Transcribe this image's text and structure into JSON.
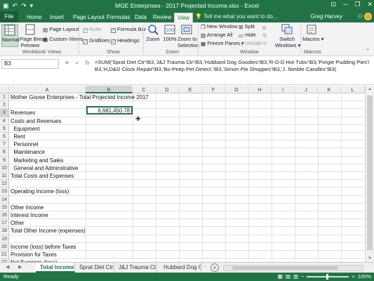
{
  "titlebar": {
    "title": "MGE Enterprises - 2017 Projected Income.xlsx - Excel",
    "min": "─",
    "max": "❐",
    "close": "✕",
    "restore": "⊡"
  },
  "tabs": [
    {
      "label": "File"
    },
    {
      "label": "Home"
    },
    {
      "label": "Insert"
    },
    {
      "label": "Page Layout"
    },
    {
      "label": "Formulas"
    },
    {
      "label": "Data"
    },
    {
      "label": "Review"
    },
    {
      "label": "View"
    }
  ],
  "tellme": "Tell me what you want to do...",
  "user": "Greg Harvey",
  "share": "Share",
  "ribbon": {
    "workbook_views": {
      "normal": "Normal",
      "page_break_1": "Page Break",
      "page_break_2": "Preview",
      "page_layout": "Page Layout",
      "custom_views": "Custom Views",
      "label": "Workbook Views"
    },
    "show": {
      "ruler": "Ruler",
      "formula_bar": "Formula Bar",
      "gridlines": "Gridlines",
      "headings": "Headings",
      "label": "Show"
    },
    "zoom": {
      "zoom": "Zoom",
      "hundred": "100%",
      "zoom_sel_1": "Zoom to",
      "zoom_sel_2": "Selection",
      "label": "Zoom"
    },
    "window": {
      "new_window": "New Window",
      "arrange_all": "Arrange All",
      "freeze": "Freeze Panes",
      "split": "Split",
      "hide": "Hide",
      "unhide": "Unhide",
      "switch_1": "Switch",
      "switch_2": "Windows",
      "label": "Window"
    },
    "macros": {
      "macros": "Macros",
      "label": "Macros"
    }
  },
  "formula_bar": {
    "name_box": "B3",
    "cancel": "✕",
    "enter": "✓",
    "fx": "fx",
    "formula": "=SUM('Sprat Diet Ctr'!B3,'J&J Trauma Ctr'!B3,'Hubbard Dog Goodies'!B3,'R-D-D Hot Tubs'!B3,'Porgie Pudding Pies'!B3,'H,D&D Clock Repair'!B3,'Bo-Peep Pet Detect.'!B3,'Simon Pie Shoppes'!B3,'J. Nimble Candles'!B3)"
  },
  "columns": [
    "A",
    "B",
    "C",
    "D",
    "E",
    "F",
    "G",
    "H",
    "I",
    "J",
    "K",
    "L"
  ],
  "rows": [
    {
      "num": "1",
      "a": "Mother Goose Enterprises - Total Projected Income 2017"
    },
    {
      "num": "2",
      "a": ""
    },
    {
      "num": "3",
      "a": "Revenues"
    },
    {
      "num": "4",
      "a": "Costs and Revenues"
    },
    {
      "num": "5",
      "a": "  Equipment"
    },
    {
      "num": "6",
      "a": "  Rent"
    },
    {
      "num": "7",
      "a": "  Personnel"
    },
    {
      "num": "8",
      "a": "  Maintenance"
    },
    {
      "num": "9",
      "a": "  Marketing and Sales"
    },
    {
      "num": "10",
      "a": "  General and Adminstrative"
    },
    {
      "num": "11",
      "a": "Total Costs and Expenses"
    },
    {
      "num": "12",
      "a": ""
    },
    {
      "num": "13",
      "a": "Operating Income (loss)"
    },
    {
      "num": "14",
      "a": ""
    },
    {
      "num": "15",
      "a": "Other Income"
    },
    {
      "num": "16",
      "a": "Interest Income"
    },
    {
      "num": "17",
      "a": "Other"
    },
    {
      "num": "18",
      "a": "Total Other Income (expenses)"
    },
    {
      "num": "19",
      "a": ""
    },
    {
      "num": "20",
      "a": "Income (loss) before Taxes"
    },
    {
      "num": "21",
      "a": "Provision for Taxes"
    },
    {
      "num": "22",
      "a": "Net Earnings (loss)"
    },
    {
      "num": "23",
      "a": ""
    }
  ],
  "cell_b3": "6,681,450.78",
  "sheets": {
    "prev": "◀",
    "next": "▶",
    "tabs": [
      "Total Income",
      "Sprat Diet Ctr",
      "J&J Trauma Ctr",
      "Hubbard Dog Go"
    ],
    "more": "...",
    "add": "+"
  },
  "status": {
    "ready": "Ready",
    "zoom_out": "−",
    "zoom_in": "+",
    "zoom_level": "100%"
  },
  "colors": {
    "accent": "#217346"
  }
}
